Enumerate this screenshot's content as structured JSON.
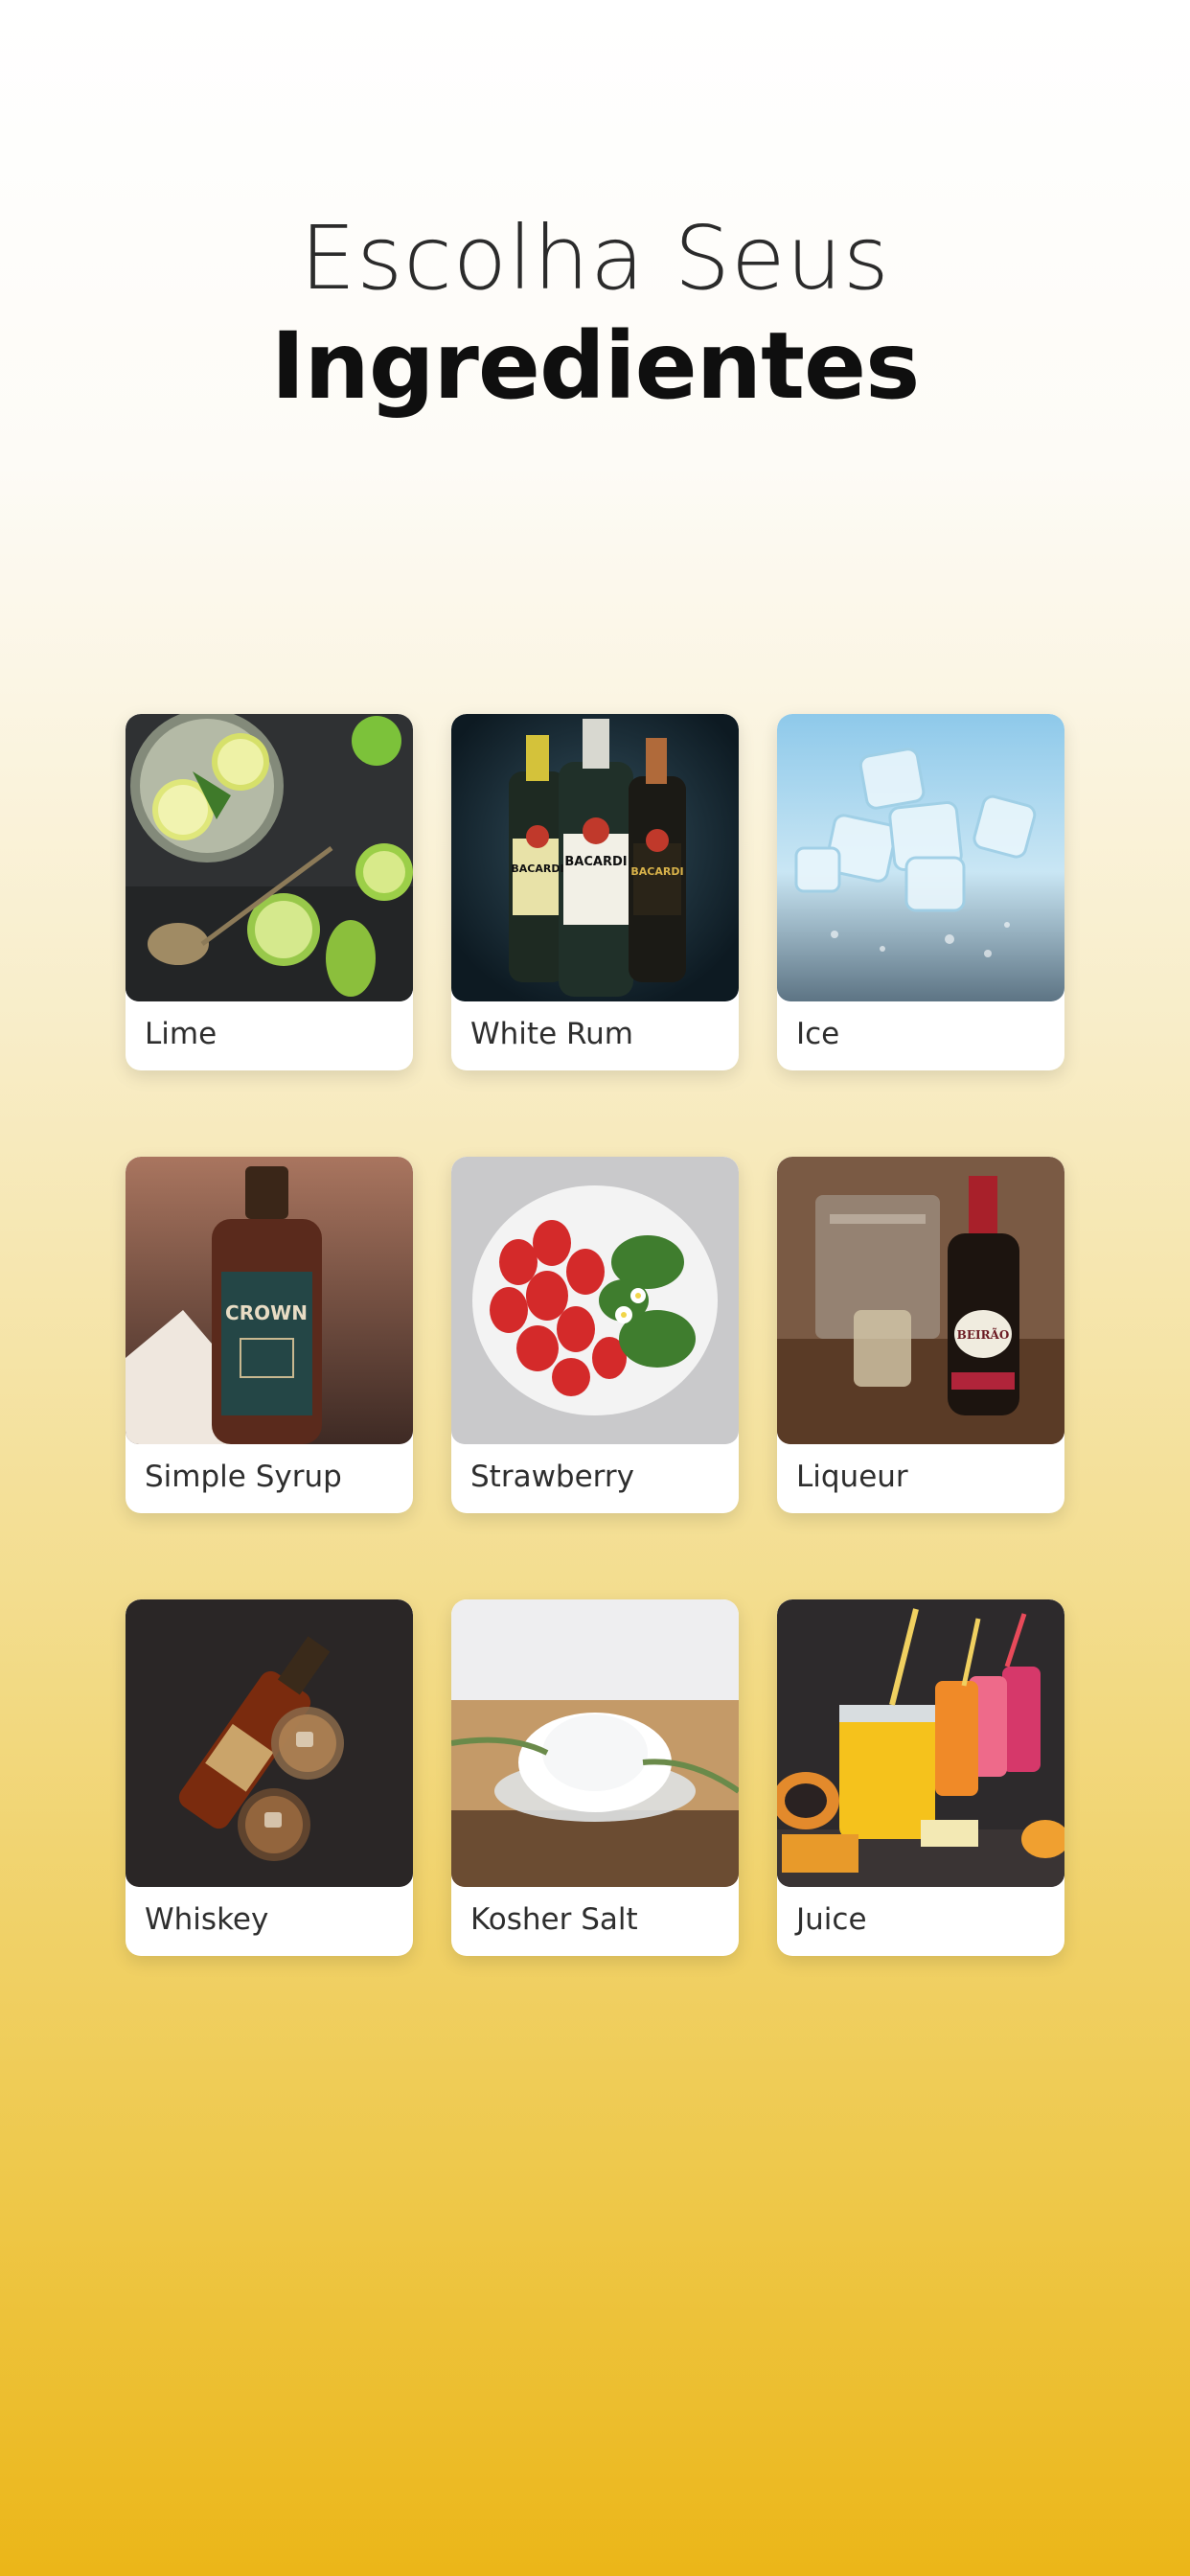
{
  "header": {
    "title_line1": "Escolha Seus",
    "title_line2": "Ingredientes"
  },
  "ingredients": [
    {
      "label": "Lime",
      "image": "lime-photo"
    },
    {
      "label": "White Rum",
      "image": "white-rum-bottles-photo"
    },
    {
      "label": "Ice",
      "image": "ice-cubes-photo"
    },
    {
      "label": "Simple Syrup",
      "image": "simple-syrup-bottle-photo"
    },
    {
      "label": "Strawberry",
      "image": "strawberry-bowl-photo"
    },
    {
      "label": "Liqueur",
      "image": "liqueur-bottle-photo"
    },
    {
      "label": "Whiskey",
      "image": "whiskey-bottle-photo"
    },
    {
      "label": "Kosher Salt",
      "image": "kosher-salt-bowl-photo"
    },
    {
      "label": "Juice",
      "image": "juice-jars-photo"
    }
  ],
  "product_text": {
    "rum_brand": "BACARDI",
    "syrup_brand": "CROWN",
    "liqueur_brand": "BEIRÃO"
  },
  "colors": {
    "background_top": "#ffffff",
    "background_bottom": "#ebb618",
    "card": "#ffffff",
    "label_text": "#2e2e2e"
  }
}
